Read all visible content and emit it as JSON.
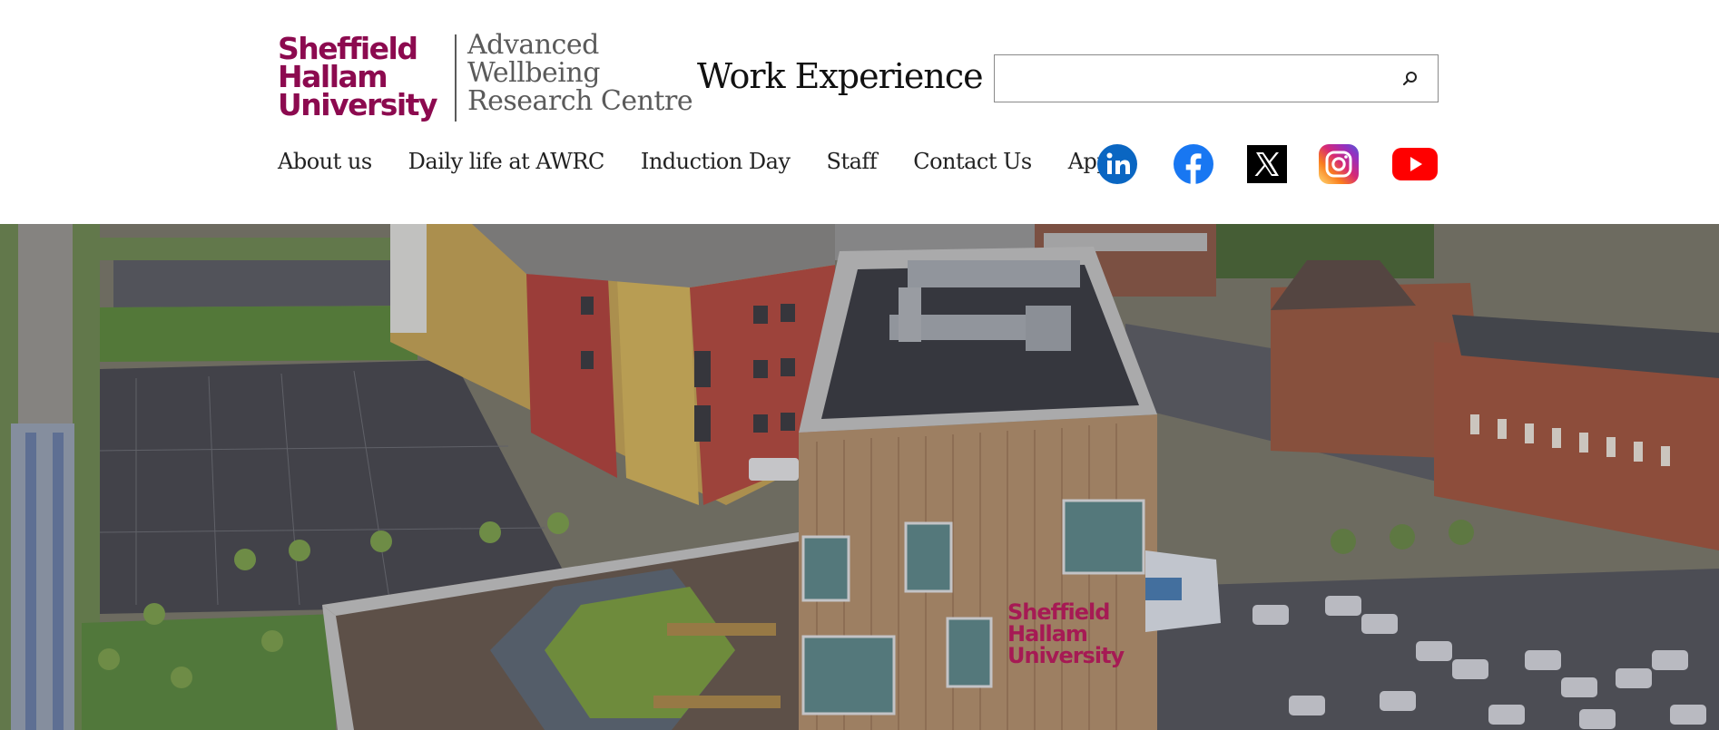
{
  "logo": {
    "university_lines": [
      "Sheffield",
      "Hallam",
      "University"
    ],
    "centre_lines": [
      "Advanced",
      "Wellbeing",
      "Research Centre"
    ]
  },
  "page": {
    "title": "Work Experience"
  },
  "search": {
    "value": "",
    "placeholder": "",
    "icon": "search-icon"
  },
  "nav": {
    "items": [
      {
        "label": "About us"
      },
      {
        "label": "Daily life at AWRC"
      },
      {
        "label": "Induction Day"
      },
      {
        "label": "Staff"
      },
      {
        "label": "Contact Us"
      },
      {
        "label": "Apply"
      }
    ]
  },
  "social": [
    {
      "icon": "linkedin-icon",
      "color": "#0a66c2"
    },
    {
      "icon": "facebook-icon",
      "color": "#1877f2"
    },
    {
      "icon": "x-icon",
      "color": "#000000"
    },
    {
      "icon": "instagram-icon",
      "color": "#e1306c"
    },
    {
      "icon": "youtube-icon",
      "color": "#ff0000"
    }
  ],
  "hero": {
    "building_sign_lines": [
      "Sheffield",
      "Hallam",
      "University"
    ]
  },
  "colors": {
    "brand": "#8c0a4f",
    "text": "#222222",
    "secondary_text": "#5a5a5a"
  }
}
